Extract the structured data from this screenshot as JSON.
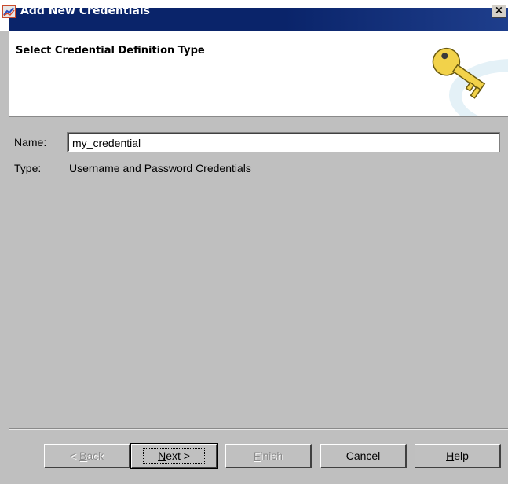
{
  "window": {
    "title": "Add New Credentials",
    "close_glyph": "×",
    "app_icon": "chart-app-icon"
  },
  "header": {
    "title": "Select Credential Definition Type",
    "graphic": "key-icon"
  },
  "form": {
    "name_label": "Name:",
    "name_value": "my_credential",
    "type_label": "Type:",
    "type_value": "Username and Password Credentials"
  },
  "buttons": {
    "back": {
      "prefix": "< ",
      "mnemonic": "B",
      "rest": "ack",
      "enabled": false
    },
    "next": {
      "mnemonic": "N",
      "rest": "ext >",
      "enabled": true
    },
    "finish": {
      "mnemonic": "F",
      "rest": "inish",
      "enabled": false
    },
    "cancel": {
      "label": "Cancel",
      "enabled": true
    },
    "help": {
      "mnemonic": "H",
      "rest": "elp",
      "enabled": true
    }
  },
  "colors": {
    "titlebar": "#0a246a",
    "dialog_body": "#bfbfbf",
    "key_gold": "#f2d24a"
  }
}
